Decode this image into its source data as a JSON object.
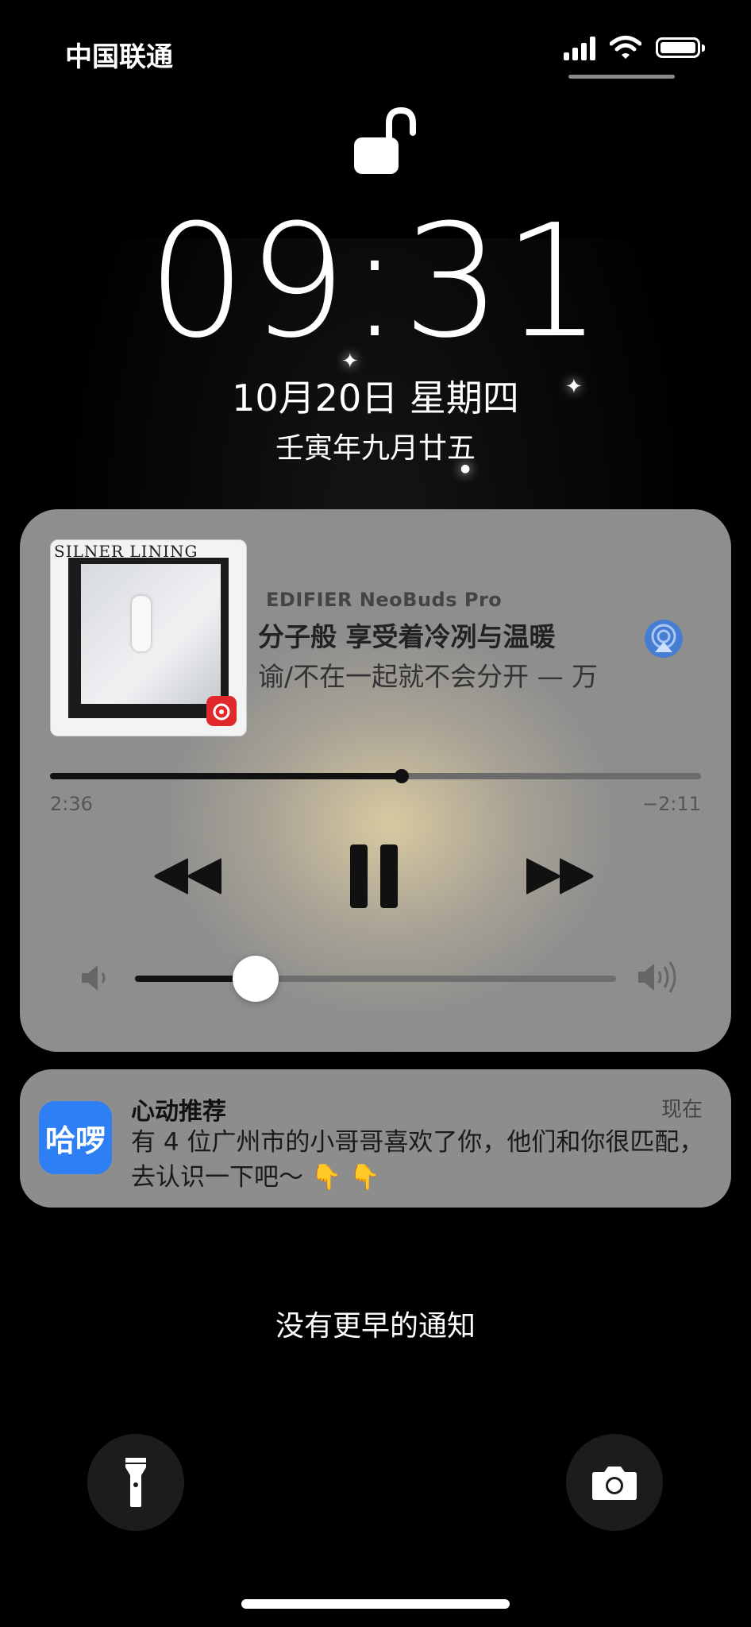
{
  "status_bar": {
    "carrier": "中国联通",
    "signal_icon": "signal-bars-icon",
    "wifi_icon": "wifi-icon",
    "battery_icon": "battery-icon",
    "battery_level": 1.0
  },
  "lock_screen": {
    "lock_icon": "unlocked-padlock-icon",
    "time": "09:31",
    "date": "10月20日 星期四",
    "lunar_date": "壬寅年九月廿五"
  },
  "now_playing": {
    "album_art_text": "SILNER LINING",
    "music_app_icon": "netease-music-icon",
    "output_device": "EDIFIER NeoBuds Pro",
    "track_title": "分子般 享受着冷冽与温暖",
    "track_artist": "谕/不在一起就不会分开 — 万",
    "elapsed": "2:36",
    "remaining": "−2:11",
    "progress": 0.54,
    "volume": 0.25,
    "airplay_icon": "airplay-audio-icon",
    "controls": {
      "rewind_icon": "rewind-icon",
      "pause_icon": "pause-icon",
      "fast_forward_icon": "fast-forward-icon"
    },
    "volume_low_icon": "speaker-low-icon",
    "volume_high_icon": "speaker-high-icon"
  },
  "notification": {
    "app_icon_label": "哈啰",
    "title": "心动推荐",
    "time": "现在",
    "body": "有 4 位广州市的小哥哥喜欢了你，他们和你很匹配，去认识一下吧～ 👇 👇"
  },
  "footer": {
    "no_earlier_text": "没有更早的通知",
    "flashlight_icon": "flashlight-icon",
    "camera_icon": "camera-icon"
  },
  "colors": {
    "app_icon_blue": "#2f7ff4",
    "airplay_blue": "#3d7bd9",
    "music_badge_red": "#e0282c"
  }
}
